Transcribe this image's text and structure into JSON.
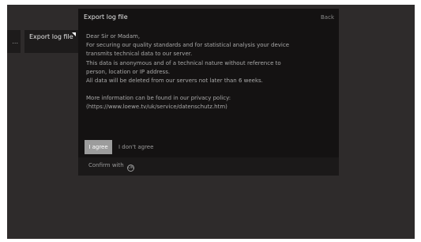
{
  "menu": {
    "stub_glyph": "...",
    "item_label": "Export log file"
  },
  "dialog": {
    "title": "Export log file",
    "back_label": "Back",
    "greeting": "Dear Sir or Madam,",
    "lines": [
      "For securing our quality standards and for statistical analysis your device",
      "transmits technical data to our server.",
      "This data is anonymous and of a technical nature without reference to",
      "person, location or IP address.",
      "All data will be deleted from our servers not later than 6 weeks."
    ],
    "more_info_lines": [
      "More information can be found in our privacy policy:",
      "(https://www.loewe.tv/uk/service/datenschutz.htm)"
    ],
    "agree_label": "I agree",
    "disagree_label": "I don't agree",
    "footer_text": "Confirm with",
    "footer_icon": "ok-circle-icon",
    "footer_icon_glyph": "OK"
  }
}
